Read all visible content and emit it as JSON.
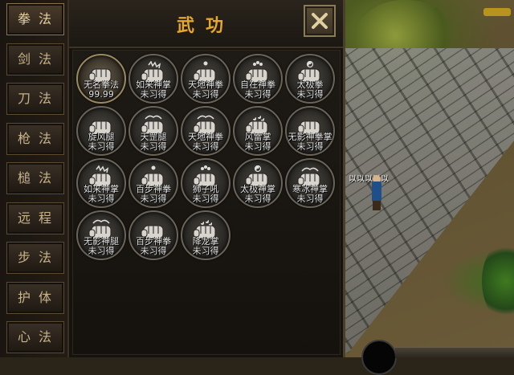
{
  "window": {
    "title": "武功"
  },
  "tabs": [
    {
      "label": "拳法",
      "active": true
    },
    {
      "label": "剑法",
      "active": false
    },
    {
      "label": "刀法",
      "active": false
    },
    {
      "label": "枪法",
      "active": false
    },
    {
      "label": "槌法",
      "active": false
    },
    {
      "label": "远程",
      "active": false
    },
    {
      "label": "步法",
      "active": false
    },
    {
      "label": "护体",
      "active": false
    },
    {
      "label": "心法",
      "active": false
    }
  ],
  "skills": [
    {
      "name": "无名拳法",
      "status": "99.99",
      "icon": "fist-icon",
      "learned": true
    },
    {
      "name": "如来神掌",
      "status": "未习得",
      "icon": "fist-spiky-icon",
      "learned": false
    },
    {
      "name": "天地神拳",
      "status": "未习得",
      "icon": "fist-dot-icon",
      "learned": false
    },
    {
      "name": "自在神拳",
      "status": "未习得",
      "icon": "fist-flower-icon",
      "learned": false
    },
    {
      "name": "太极拳",
      "status": "未习得",
      "icon": "fist-yinyang-icon",
      "learned": false
    },
    {
      "name": "旋风腿",
      "status": "未习得",
      "icon": "fist-icon",
      "learned": false
    },
    {
      "name": "天罡腿",
      "status": "未习得",
      "icon": "fist-wing-icon",
      "learned": false
    },
    {
      "name": "天地神拳",
      "status": "未习得",
      "icon": "fist-wing-icon",
      "learned": false
    },
    {
      "name": "风雷掌",
      "status": "未习得",
      "icon": "fist-drop-icon",
      "learned": false
    },
    {
      "name": "无影神拳掌",
      "status": "未习得",
      "icon": "fist-icon",
      "learned": false
    },
    {
      "name": "如来神掌",
      "status": "未习得",
      "icon": "fist-spiky-icon",
      "learned": false
    },
    {
      "name": "百步神拳",
      "status": "未习得",
      "icon": "fist-dot-icon",
      "learned": false
    },
    {
      "name": "狮子吼",
      "status": "未习得",
      "icon": "fist-flower-icon",
      "learned": false
    },
    {
      "name": "太极神掌",
      "status": "未习得",
      "icon": "fist-yinyang-icon",
      "learned": false
    },
    {
      "name": "寒冰神掌",
      "status": "未习得",
      "icon": "fist-wing-icon",
      "learned": false
    },
    {
      "name": "无影神腿",
      "status": "未习得",
      "icon": "fist-wing-icon",
      "learned": false
    },
    {
      "name": "百步神拳",
      "status": "未习得",
      "icon": "fist-icon",
      "learned": false
    },
    {
      "name": "降龙掌",
      "status": "未习得",
      "icon": "fist-drop-icon",
      "learned": false
    }
  ],
  "world": {
    "npc_name": "以以以以以"
  }
}
